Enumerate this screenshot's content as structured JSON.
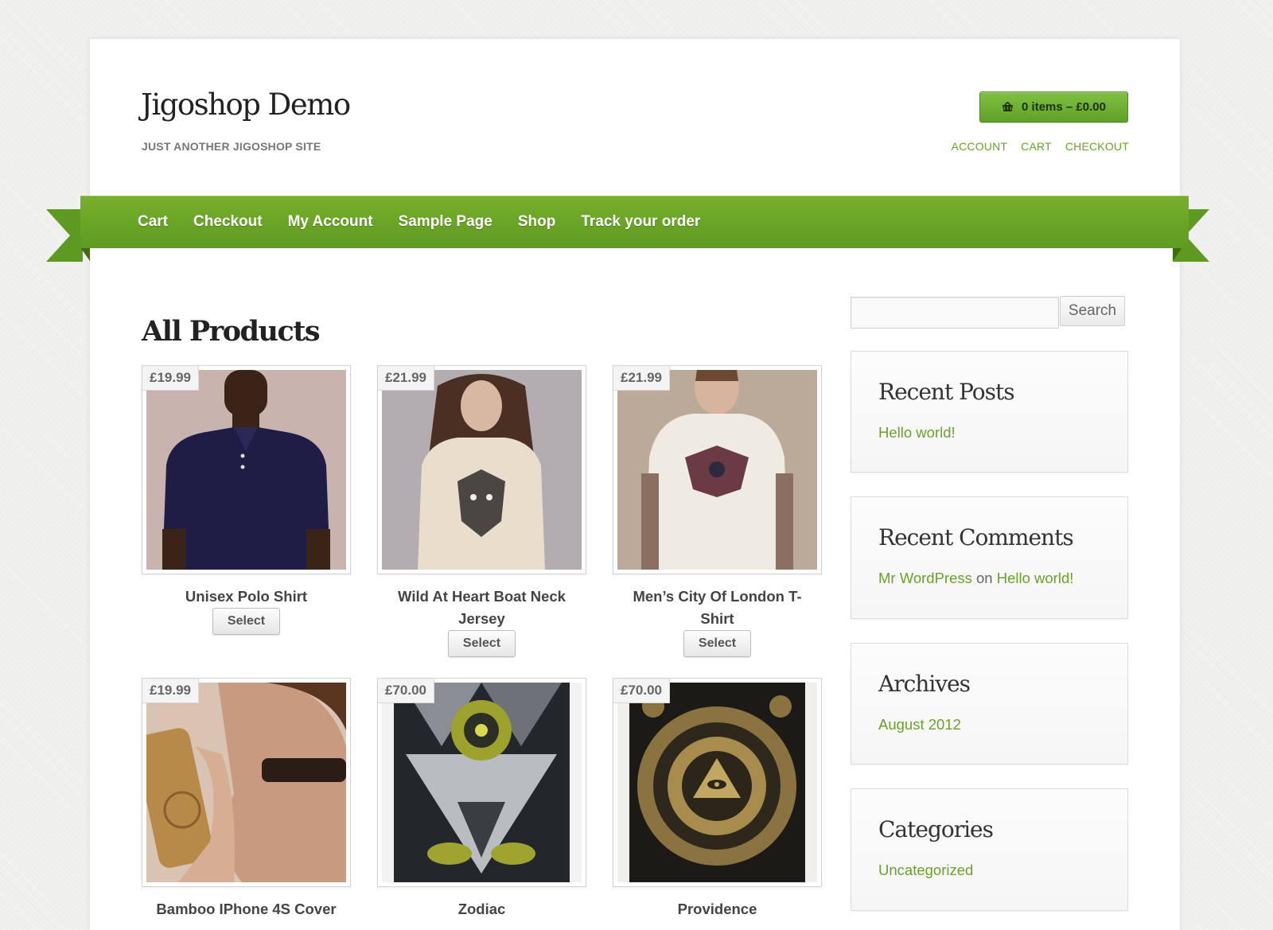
{
  "header": {
    "site_title": "Jigoshop Demo",
    "tagline": "JUST ANOTHER JIGOSHOP SITE",
    "cart_button": "0 items – £0.00",
    "links": [
      "ACCOUNT",
      "CART",
      "CHECKOUT"
    ]
  },
  "nav": [
    "Cart",
    "Checkout",
    "My Account",
    "Sample Page",
    "Shop",
    "Track your order"
  ],
  "main": {
    "title": "All Products",
    "select_label": "Select",
    "products": [
      {
        "name": "Unisex Polo Shirt",
        "price": "£19.99",
        "image": "polo-shirt"
      },
      {
        "name": "Wild At Heart Boat Neck Jersey",
        "price": "£21.99",
        "image": "fox-jersey"
      },
      {
        "name": "Men’s City Of London T-Shirt",
        "price": "£21.99",
        "image": "london-tshirt"
      },
      {
        "name": "Bamboo IPhone 4S Cover",
        "price": "£19.99",
        "image": "bamboo-cover"
      },
      {
        "name": "Zodiac",
        "price": "£70.00",
        "image": "zodiac-poster"
      },
      {
        "name": "Providence",
        "price": "£70.00",
        "image": "providence-poster"
      }
    ]
  },
  "sidebar": {
    "search_button": "Search",
    "search_value": "",
    "widgets": {
      "recent_posts": {
        "title": "Recent Posts",
        "items": [
          "Hello world!"
        ]
      },
      "recent_comments": {
        "title": "Recent Comments",
        "author": "Mr WordPress",
        "joiner": "on",
        "post": "Hello world!"
      },
      "archives": {
        "title": "Archives",
        "items": [
          "August 2012"
        ]
      },
      "categories": {
        "title": "Categories",
        "items": [
          "Uncategorized"
        ]
      }
    }
  },
  "colors": {
    "accent_green": "#6aa12a",
    "nav_green": "#6aa626"
  }
}
